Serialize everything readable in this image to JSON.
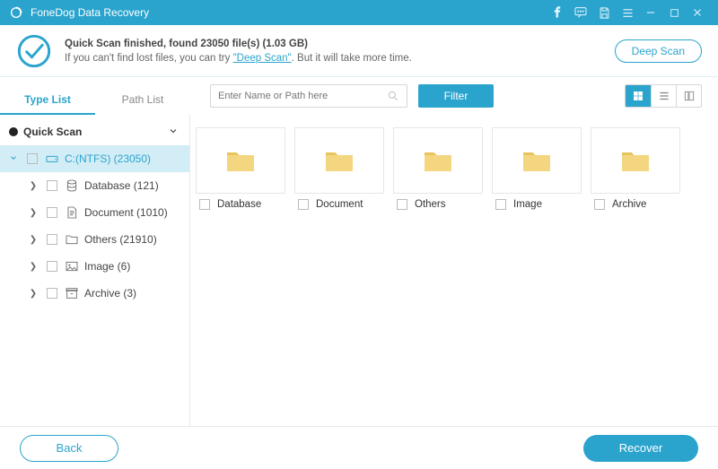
{
  "titlebar": {
    "title": "FoneDog Data Recovery"
  },
  "banner": {
    "line1": "Quick Scan finished, found 23050 file(s) (1.03 GB)",
    "line2_pre": "If you can't find lost files, you can try ",
    "deep_link": "\"Deep Scan\"",
    "line2_post": ". But it will take more time.",
    "deep_scan_btn": "Deep Scan"
  },
  "tabs": {
    "type_list": "Type List",
    "path_list": "Path List"
  },
  "search": {
    "placeholder": "Enter Name or Path here"
  },
  "filter_btn": "Filter",
  "tree": {
    "root": "Quick Scan",
    "drive": "C:(NTFS) (23050)",
    "children": [
      {
        "label": "Database (121)",
        "icon": "database"
      },
      {
        "label": "Document (1010)",
        "icon": "document"
      },
      {
        "label": "Others (21910)",
        "icon": "folder"
      },
      {
        "label": "Image (6)",
        "icon": "image"
      },
      {
        "label": "Archive (3)",
        "icon": "archive"
      }
    ]
  },
  "tiles": [
    {
      "label": "Database"
    },
    {
      "label": "Document"
    },
    {
      "label": "Others"
    },
    {
      "label": "Image"
    },
    {
      "label": "Archive"
    }
  ],
  "footer": {
    "back": "Back",
    "recover": "Recover"
  }
}
